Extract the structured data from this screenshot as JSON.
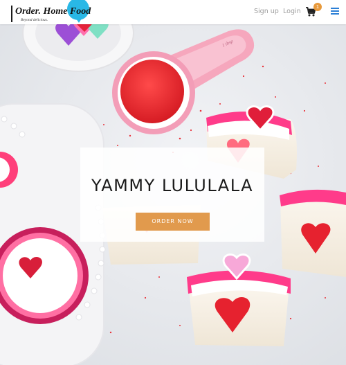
{
  "brand": {
    "title": "Order. Home Food",
    "tagline": "Beyond delicious."
  },
  "nav": {
    "signup": "Sign up",
    "login": "Login",
    "cart_count": "1"
  },
  "hero": {
    "title": "YAMMY LULULALA",
    "button_label": "ORDER NOW",
    "spoon_text": "1 tbsp"
  },
  "colors": {
    "accent": "#e19a4d",
    "badge": "#e89a3c",
    "menu_icon": "#2b7fd6",
    "logo_balloon": "#29b8e6"
  },
  "icons": [
    "cart-icon",
    "menu-icon"
  ]
}
